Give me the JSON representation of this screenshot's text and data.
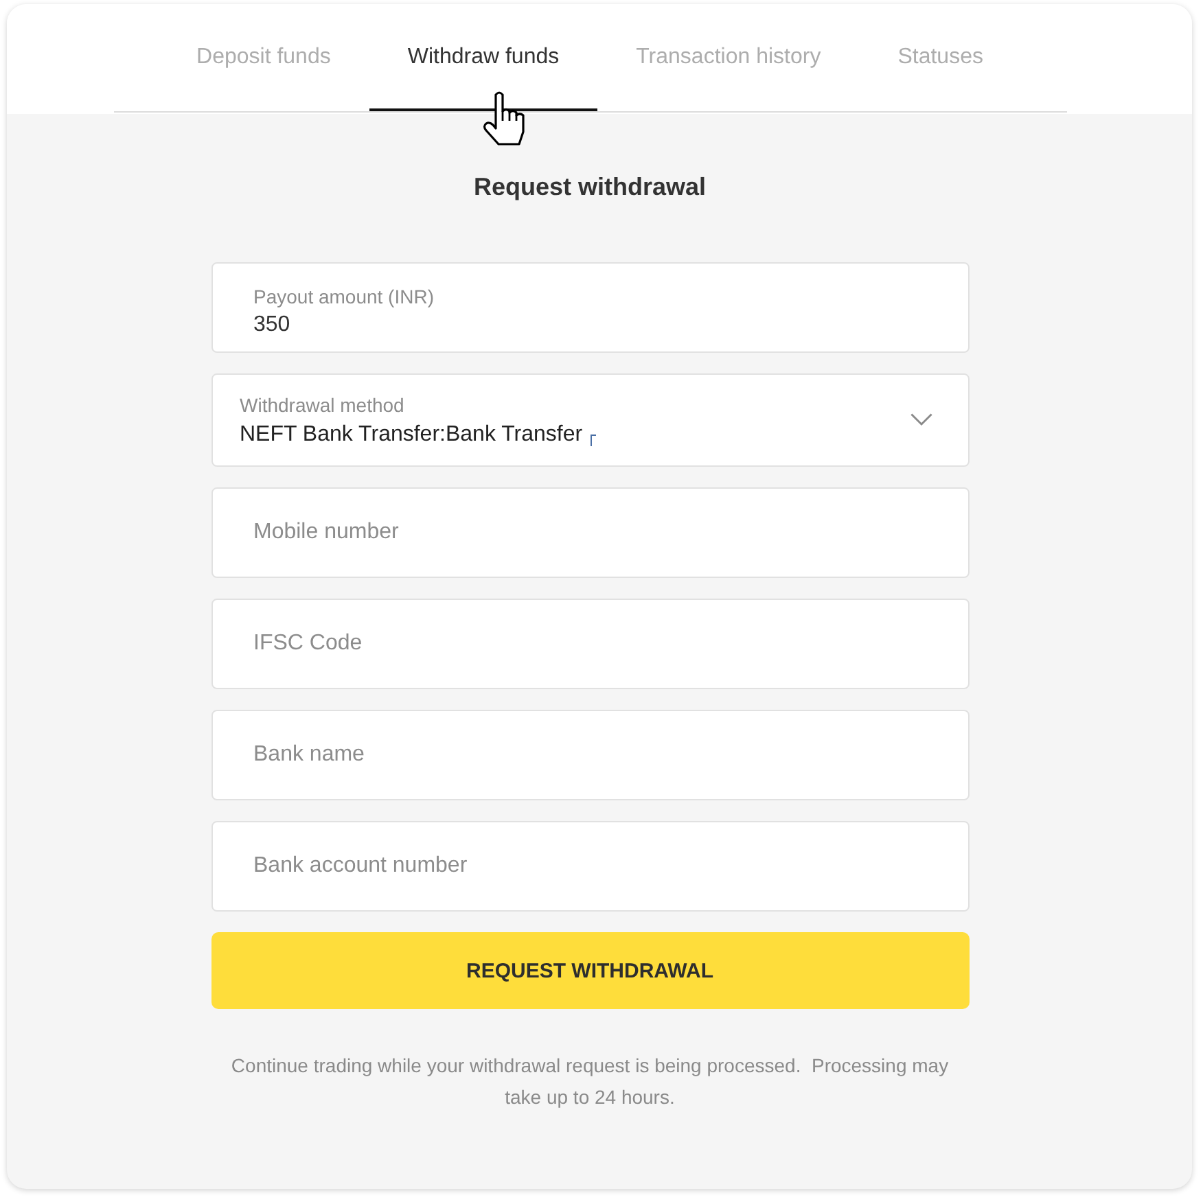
{
  "tabs": [
    {
      "label": "Deposit funds",
      "selected": false
    },
    {
      "label": "Withdraw funds",
      "selected": true
    },
    {
      "label": "Transaction history",
      "selected": false
    },
    {
      "label": "Statuses",
      "selected": false
    }
  ],
  "form": {
    "title": "Request withdrawal",
    "fields": [
      {
        "kind": "amount",
        "label": "Payout amount (INR)",
        "value": "350"
      },
      {
        "kind": "select",
        "label": "Withdrawal method",
        "value": "NEFT Bank Transfer:Bank Transfer"
      },
      {
        "kind": "text",
        "placeholder": "Mobile number"
      },
      {
        "kind": "text",
        "placeholder": "IFSC Code"
      },
      {
        "kind": "text",
        "placeholder": "Bank name"
      },
      {
        "kind": "text",
        "placeholder": "Bank account number"
      }
    ],
    "submit_button": "REQUEST WITHDRAWAL",
    "note": "Continue trading while your withdrawal request is being processed.  Processing may take up to 24 hours."
  }
}
